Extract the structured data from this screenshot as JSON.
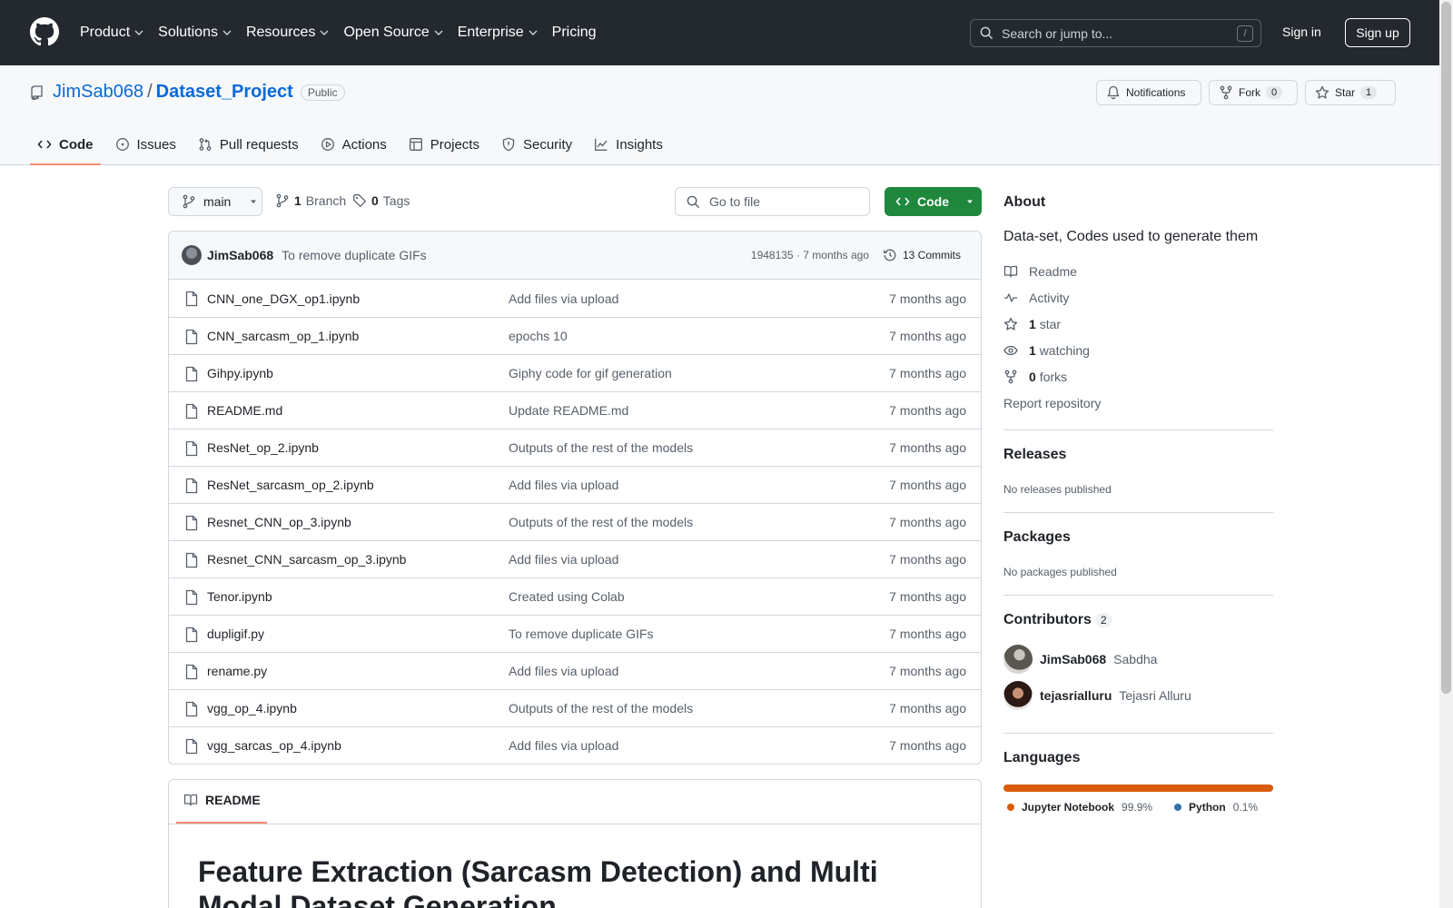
{
  "header": {
    "nav": [
      {
        "label": "Product",
        "dropdown": true
      },
      {
        "label": "Solutions",
        "dropdown": true
      },
      {
        "label": "Resources",
        "dropdown": true
      },
      {
        "label": "Open Source",
        "dropdown": true
      },
      {
        "label": "Enterprise",
        "dropdown": true
      },
      {
        "label": "Pricing",
        "dropdown": false
      }
    ],
    "search_placeholder": "Search or jump to...",
    "search_shortcut": "/",
    "sign_in": "Sign in",
    "sign_up": "Sign up"
  },
  "repo": {
    "owner": "JimSab068",
    "separator": "/",
    "name": "Dataset_Project",
    "visibility": "Public",
    "notifications_label": "Notifications",
    "fork_label": "Fork",
    "fork_count": "0",
    "star_label": "Star",
    "star_count": "1",
    "tabs": [
      {
        "label": "Code",
        "icon": "code-icon",
        "active": true
      },
      {
        "label": "Issues",
        "icon": "issue-icon",
        "active": false
      },
      {
        "label": "Pull requests",
        "icon": "pull-request-icon",
        "active": false
      },
      {
        "label": "Actions",
        "icon": "play-icon",
        "active": false
      },
      {
        "label": "Projects",
        "icon": "table-icon",
        "active": false
      },
      {
        "label": "Security",
        "icon": "shield-icon",
        "active": false
      },
      {
        "label": "Insights",
        "icon": "graph-icon",
        "active": false
      }
    ]
  },
  "toolbar": {
    "branch": "main",
    "branch_count": "1",
    "branch_label": "Branch",
    "tag_count": "0",
    "tag_label": "Tags",
    "goto_placeholder": "Go to file",
    "code_button": "Code"
  },
  "latest_commit": {
    "author": "JimSab068",
    "message": "To remove duplicate GIFs",
    "meta": "1948135 · 7 months ago",
    "commits_label": "13 Commits"
  },
  "files": [
    {
      "name": "CNN_one_DGX_op1.ipynb",
      "message": "Add files via upload",
      "time": "7 months ago"
    },
    {
      "name": "CNN_sarcasm_op_1.ipynb",
      "message": "epochs 10",
      "time": "7 months ago"
    },
    {
      "name": "Gihpy.ipynb",
      "message": "Giphy code for gif generation",
      "time": "7 months ago"
    },
    {
      "name": "README.md",
      "message": "Update README.md",
      "time": "7 months ago"
    },
    {
      "name": "ResNet_op_2.ipynb",
      "message": "Outputs of the rest of the models",
      "time": "7 months ago"
    },
    {
      "name": "ResNet_sarcasm_op_2.ipynb",
      "message": "Add files via upload",
      "time": "7 months ago"
    },
    {
      "name": "Resnet_CNN_op_3.ipynb",
      "message": "Outputs of the rest of the models",
      "time": "7 months ago"
    },
    {
      "name": "Resnet_CNN_sarcasm_op_3.ipynb",
      "message": "Add files via upload",
      "time": "7 months ago"
    },
    {
      "name": "Tenor.ipynb",
      "message": "Created using Colab",
      "time": "7 months ago"
    },
    {
      "name": "dupligif.py",
      "message": "To remove duplicate GIFs",
      "time": "7 months ago"
    },
    {
      "name": "rename.py",
      "message": "Add files via upload",
      "time": "7 months ago"
    },
    {
      "name": "vgg_op_4.ipynb",
      "message": "Outputs of the rest of the models",
      "time": "7 months ago"
    },
    {
      "name": "vgg_sarcas_op_4.ipynb",
      "message": "Add files via upload",
      "time": "7 months ago"
    }
  ],
  "readme": {
    "tab_label": "README",
    "heading": "Feature Extraction (Sarcasm Detection) and Multi Modal Dataset Generation"
  },
  "about": {
    "title": "About",
    "description": "Data-set, Codes used to generate them",
    "readme_link": "Readme",
    "activity_link": "Activity",
    "stars_count": "1",
    "stars_label": "star",
    "watching_count": "1",
    "watching_label": "watching",
    "forks_count": "0",
    "forks_label": "forks",
    "report": "Report repository"
  },
  "releases": {
    "title": "Releases",
    "empty": "No releases published"
  },
  "packages": {
    "title": "Packages",
    "empty": "No packages published"
  },
  "contributors": {
    "title": "Contributors",
    "count": "2",
    "list": [
      {
        "login": "JimSab068",
        "name": "Sabdha"
      },
      {
        "login": "tejasrialluru",
        "name": "Tejasri Alluru"
      }
    ]
  },
  "languages": {
    "title": "Languages",
    "list": [
      {
        "name": "Jupyter Notebook",
        "percent": "99.9%",
        "share": 0.999,
        "color": "#DA5B0B"
      },
      {
        "name": "Python",
        "percent": "0.1%",
        "share": 0.001,
        "color": "#3572A5"
      }
    ]
  }
}
